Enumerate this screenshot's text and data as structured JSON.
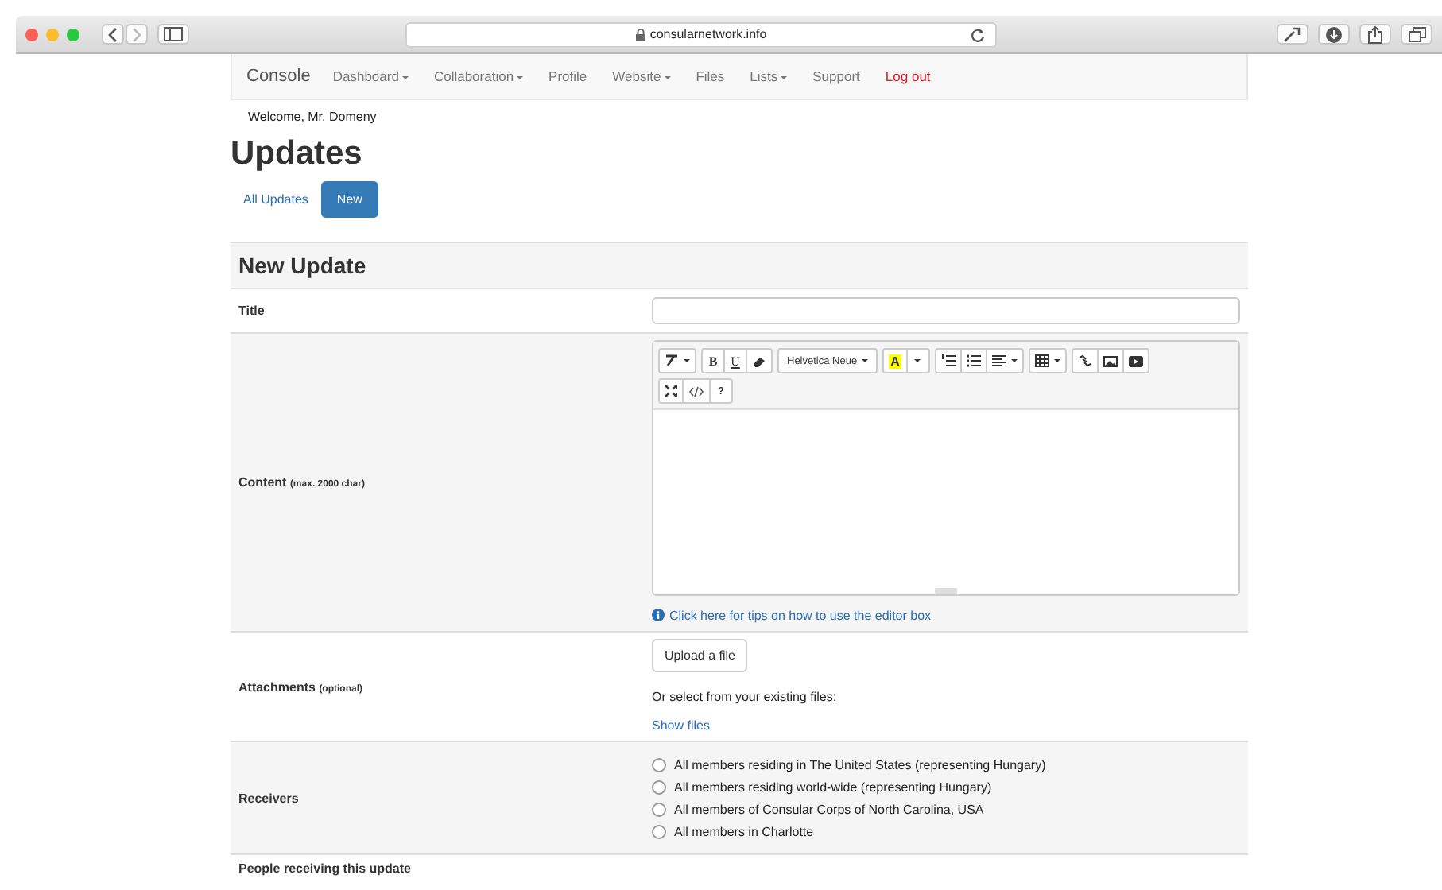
{
  "browser": {
    "address": "consularnetwork.info"
  },
  "navbar": {
    "brand": "Console",
    "items": [
      {
        "label": "Dashboard",
        "dropdown": true,
        "kind": "normal"
      },
      {
        "label": "Collaboration",
        "dropdown": true,
        "kind": "normal"
      },
      {
        "label": "Profile",
        "dropdown": false,
        "kind": "normal"
      },
      {
        "label": "Website",
        "dropdown": true,
        "kind": "normal"
      },
      {
        "label": "Files",
        "dropdown": false,
        "kind": "normal"
      },
      {
        "label": "Lists",
        "dropdown": true,
        "kind": "normal"
      },
      {
        "label": "Support",
        "dropdown": false,
        "kind": "normal"
      },
      {
        "label": "Log out",
        "dropdown": false,
        "kind": "danger"
      }
    ]
  },
  "welcome": "Welcome, Mr. Domeny",
  "page_title": "Updates",
  "tabs": [
    {
      "label": "All Updates",
      "selected": false
    },
    {
      "label": "New",
      "selected": true
    }
  ],
  "form": {
    "heading": "New Update",
    "title_label": "Title",
    "content_label": "Content",
    "content_note": "(max. 2000 char)",
    "toolbar": [
      [
        [
          {
            "kind": "style"
          }
        ],
        [
          {
            "kind": "bold",
            "label": "B"
          },
          {
            "kind": "underline",
            "label": "U"
          },
          {
            "kind": "eraser"
          }
        ],
        [
          {
            "kind": "font",
            "label": "Helvetica Neue"
          }
        ],
        [
          {
            "kind": "color",
            "label": "A"
          },
          {
            "kind": "caret"
          }
        ],
        [
          {
            "kind": "ol"
          },
          {
            "kind": "ul"
          },
          {
            "kind": "align"
          }
        ],
        [
          {
            "kind": "table"
          }
        ],
        [
          {
            "kind": "link"
          },
          {
            "kind": "picture"
          },
          {
            "kind": "video"
          }
        ]
      ],
      [
        [
          {
            "kind": "fullscreen"
          },
          {
            "kind": "code"
          },
          {
            "kind": "help",
            "label": "?"
          }
        ]
      ]
    ],
    "tips_link": "Click here for tips on how to use the editor box",
    "attachments_label": "Attachments",
    "attachments_note": "(optional)",
    "upload_button": "Upload a file",
    "existing_text": "Or select from your existing files:",
    "show_files": "Show files",
    "receivers_label": "Receivers",
    "receivers": [
      {
        "label": "All members residing in The United States (representing Hungary)",
        "selected": false
      },
      {
        "label": "All members residing world-wide (representing Hungary)",
        "selected": false
      },
      {
        "label": "All members of Consular Corps of North Carolina, USA",
        "selected": false
      },
      {
        "label": "All members in Charlotte",
        "selected": false
      }
    ],
    "people_label": "People receiving this update"
  }
}
